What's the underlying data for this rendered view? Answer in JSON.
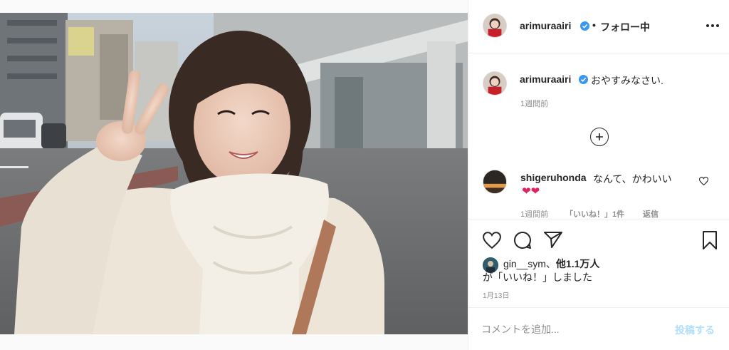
{
  "post": {
    "author": "arimuraairi",
    "follow_status": "フォロー中",
    "separator": "•"
  },
  "caption": {
    "author": "arimuraairi",
    "text": "おやすみなさい.",
    "time": "1週間前"
  },
  "comments": [
    {
      "author": "shigeruhonda",
      "text": "なんて、かわいい",
      "emoji": "❤❤",
      "time": "1週間前",
      "likes": "「いいね！」1件",
      "reply": "返信"
    }
  ],
  "likes": {
    "user": "gin__sym",
    "sep": "、",
    "others": "他1.1万人",
    "suffix": "が「いいね！」しました"
  },
  "date": "1月13日",
  "comment_form": {
    "placeholder": "コメントを追加...",
    "post_label": "投稿する",
    "post_color": "#b2dffc"
  },
  "colors": {
    "verified": "#3897f0",
    "text": "#262626",
    "meta": "#8e8e8e"
  }
}
